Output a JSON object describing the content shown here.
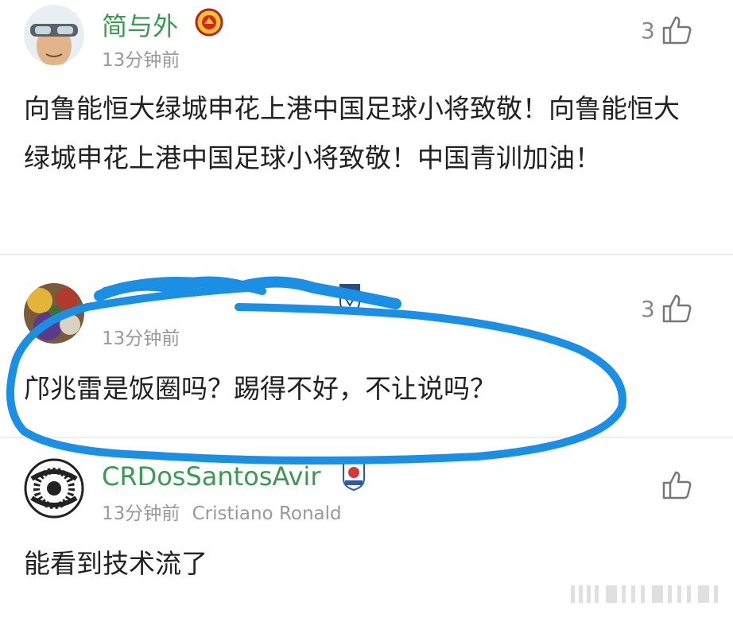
{
  "comments": [
    {
      "username": "简与外",
      "time": "13分钟前",
      "likes": "3",
      "text": "向鲁能恒大绿城申花上港中国足球小将致敬！向鲁能恒大绿城申花上港中国足球小将致敬！中国青训加油！",
      "badge_icon": "manchester-united-crest-icon"
    },
    {
      "username": "",
      "time": "13分钟前",
      "likes": "3",
      "text": "邝兆雷是饭圈吗？踢得不好，不让说吗？",
      "badge_icon": "club-crest-icon"
    },
    {
      "username": "CRDosSantosAvir",
      "time": "13分钟前",
      "team": "Cristiano Ronald",
      "likes": "",
      "text": "能看到技术流了",
      "badge_icon": "club-shield-icon"
    }
  ],
  "colors": {
    "username": "#3a9a52",
    "annotation": "#1a8fe3",
    "meta": "#999999"
  }
}
